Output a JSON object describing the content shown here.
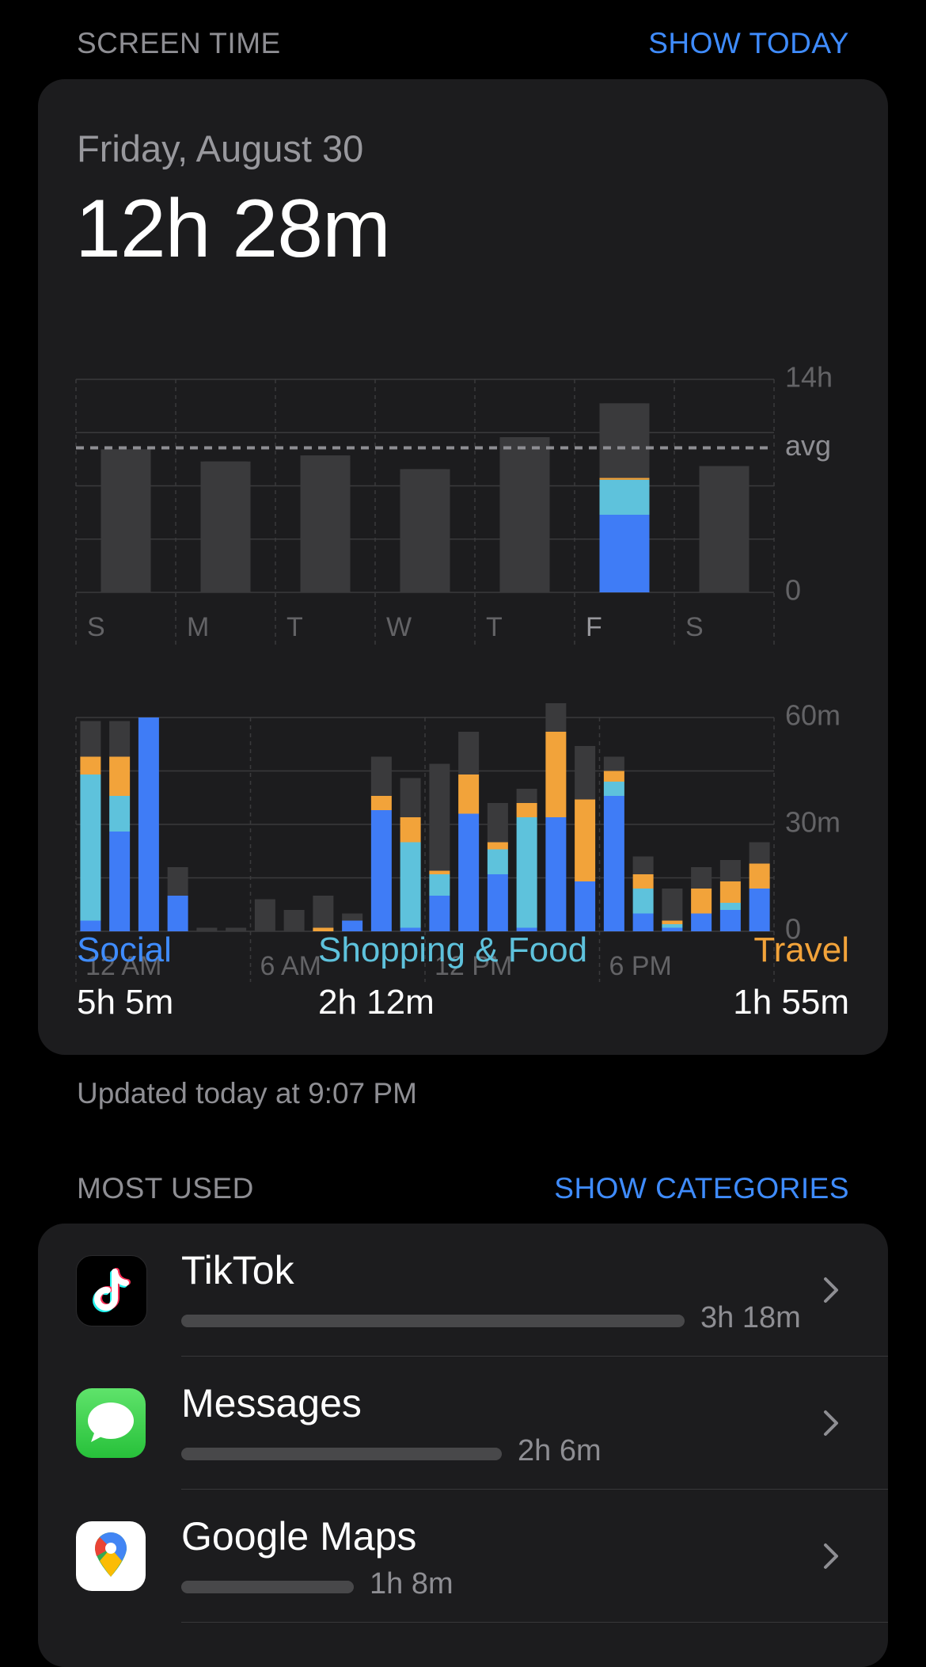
{
  "screen_time_header": {
    "label": "SCREEN TIME",
    "action": "SHOW TODAY"
  },
  "summary": {
    "date": "Friday, August 30",
    "total": "12h 28m"
  },
  "colors": {
    "social": "#3f7cf6",
    "shopping": "#5ec2dc",
    "travel": "#f2a33a",
    "other": "#3a3a3c",
    "accent": "#3f8cff",
    "card": "#1c1c1e"
  },
  "chart_data": [
    {
      "type": "bar",
      "title": "",
      "categories": [
        "S",
        "M",
        "T",
        "W",
        "T",
        "F",
        "S"
      ],
      "y_ticks": [
        "14h",
        "avg",
        "0"
      ],
      "ylim_hours": [
        0,
        14
      ],
      "average_hours": 9.5,
      "selected_index": 5,
      "series": [
        {
          "key": "other",
          "values": [
            9.4,
            8.6,
            9.0,
            8.1,
            10.2,
            4.9,
            8.3
          ]
        },
        {
          "key": "travel",
          "values": [
            0,
            0,
            0,
            0,
            0,
            0.12,
            0
          ]
        },
        {
          "key": "shopping",
          "values": [
            0,
            0,
            0,
            0,
            0,
            2.3,
            0
          ]
        },
        {
          "key": "social",
          "values": [
            0,
            0,
            0,
            0,
            0,
            5.1,
            0
          ]
        }
      ]
    },
    {
      "type": "bar",
      "title": "",
      "x_ticks": [
        "12 AM",
        "6 AM",
        "12 PM",
        "6 PM"
      ],
      "y_ticks": [
        "60m",
        "30m",
        "0"
      ],
      "ylim_minutes": [
        0,
        60
      ],
      "hours": [
        0,
        1,
        2,
        3,
        4,
        5,
        6,
        7,
        8,
        9,
        10,
        11,
        12,
        13,
        14,
        15,
        16,
        17,
        18,
        19,
        20,
        21,
        22,
        23
      ],
      "series": [
        {
          "key": "social",
          "values": [
            3,
            28,
            60,
            10,
            0,
            0,
            0,
            0,
            0,
            3,
            34,
            1,
            10,
            33,
            16,
            1,
            32,
            14,
            38,
            5,
            1,
            5,
            6,
            12
          ]
        },
        {
          "key": "shopping",
          "values": [
            41,
            10,
            0,
            0,
            0,
            0,
            0,
            0,
            0,
            0,
            0,
            24,
            6,
            0,
            7,
            31,
            0,
            0,
            4,
            7,
            1,
            0,
            2,
            0
          ]
        },
        {
          "key": "travel",
          "values": [
            5,
            11,
            0,
            0,
            0,
            0,
            0,
            0,
            1,
            0,
            4,
            7,
            1,
            11,
            2,
            4,
            24,
            23,
            3,
            4,
            1,
            7,
            6,
            7
          ]
        },
        {
          "key": "other",
          "values": [
            10,
            10,
            0,
            8,
            1,
            1,
            9,
            6,
            9,
            2,
            11,
            11,
            30,
            12,
            11,
            4,
            8,
            15,
            4,
            5,
            9,
            6,
            6,
            6
          ]
        }
      ]
    }
  ],
  "legend": [
    {
      "label": "Social",
      "value": "5h 5m"
    },
    {
      "label": "Shopping & Food",
      "value": "2h 12m"
    },
    {
      "label": "Travel",
      "value": "1h 55m"
    }
  ],
  "updated_text": "Updated today at 9:07 PM",
  "most_used_header": {
    "label": "MOST USED",
    "action": "SHOW CATEGORIES"
  },
  "apps": [
    {
      "name": "TikTok",
      "time": "3h 18m",
      "usage_minutes": 198,
      "icon": "tiktok-icon"
    },
    {
      "name": "Messages",
      "time": "2h 6m",
      "usage_minutes": 126,
      "icon": "messages-icon"
    },
    {
      "name": "Google Maps",
      "time": "1h 8m",
      "usage_minutes": 68,
      "icon": "google-maps-icon"
    }
  ]
}
